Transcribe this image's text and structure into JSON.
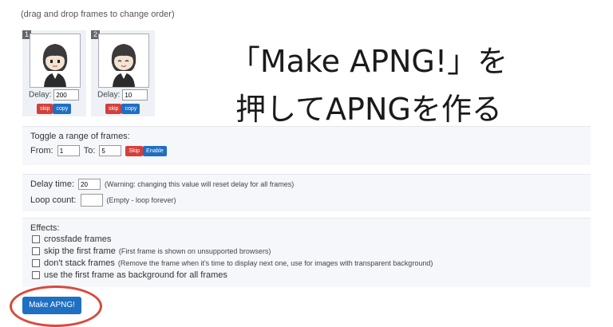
{
  "hint": "(drag and drop frames to change order)",
  "frames": [
    {
      "number": "1",
      "delay_label": "Delay:",
      "delay_value": "200",
      "skip_label": "skip",
      "copy_label": "copy",
      "mouth": "neutral"
    },
    {
      "number": "2",
      "delay_label": "Delay:",
      "delay_value": "10",
      "skip_label": "skip",
      "copy_label": "copy",
      "mouth": "smile"
    }
  ],
  "overlay": {
    "line1": "「Make APNG!」を",
    "line2": "押してAPNGを作る"
  },
  "toggle": {
    "title": "Toggle a range of frames:",
    "from_label": "From:",
    "from_value": "1",
    "to_label": "To:",
    "to_value": "5",
    "skip_label": "Skip",
    "enable_label": "Enable"
  },
  "delay": {
    "label": "Delay time:",
    "value": "20",
    "note": "(Warning: changing this value will reset delay for all frames)",
    "loop_label": "Loop count:",
    "loop_value": "",
    "loop_note": "(Empty - loop forever)"
  },
  "effects": {
    "title": "Effects:",
    "items": [
      {
        "label": "crossfade frames",
        "desc": ""
      },
      {
        "label": "skip the first frame",
        "desc": "(First frame is shown on unsupported browsers)"
      },
      {
        "label": "don't stack frames",
        "desc": "(Remove the frame when it's time to display next one, use for images with transparent background)"
      },
      {
        "label": "use the first frame as background for all frames",
        "desc": ""
      }
    ]
  },
  "make_button": "Make APNG!",
  "colors": {
    "accent_blue": "#1f6fc2",
    "danger_red": "#d43f3a",
    "annotation_red": "#d94a3a"
  }
}
